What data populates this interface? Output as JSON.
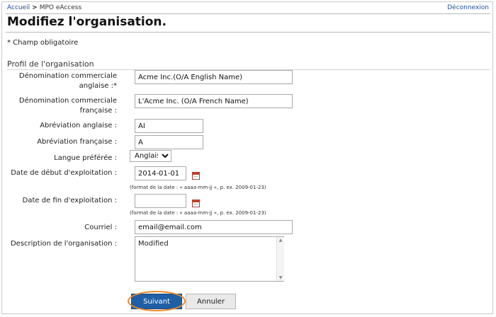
{
  "breadcrumb": {
    "home": "Accueil",
    "separator": ">",
    "current": "MPO eAccess"
  },
  "logout": "Déconnexion",
  "page_title": "Modifiez l'organisation.",
  "required_note": "* Champ obligatoire",
  "section_title": "Profil de l'organisation",
  "fields": {
    "trade_name_en": {
      "label_line1": "Dénomination commerciale",
      "label_line2": "anglaise :*",
      "value": "Acme Inc.(O/A English Name)"
    },
    "trade_name_fr": {
      "label_line1": "Dénomination commerciale",
      "label_line2": "française :",
      "value": "L'Acme Inc. (O/A French Name)"
    },
    "abbr_en": {
      "label": "Abréviation anglaise :",
      "value": "AI"
    },
    "abbr_fr": {
      "label": "Abréviation française :",
      "value": "A"
    },
    "language": {
      "label": "Langue préférée :",
      "value": "Anglais"
    },
    "start_date": {
      "label": "Date de début d'exploitation :",
      "value": "2014-01-01",
      "hint": "(format de la date : « aaaa-mm-jj », p. ex. 2009-01-23)"
    },
    "end_date": {
      "label": "Date de fin d'exploitation :",
      "value": "",
      "hint": "(format de la date : « aaaa-mm-jj », p. ex. 2009-01-23)"
    },
    "email": {
      "label": "Courriel :",
      "value": "email@email.com"
    },
    "description": {
      "label": "Description de l'organisation :",
      "value": "Modified"
    }
  },
  "buttons": {
    "next": "Suivant",
    "cancel": "Annuler"
  },
  "icons": {
    "calendar": "calendar-icon",
    "dropdown": "chevron-down-icon",
    "scroll_up": "arrow-up-icon",
    "scroll_down": "arrow-down-icon"
  },
  "colors": {
    "link": "#1f4e9c",
    "primary_button": "#1f5fa5",
    "highlight": "#f08a24"
  }
}
